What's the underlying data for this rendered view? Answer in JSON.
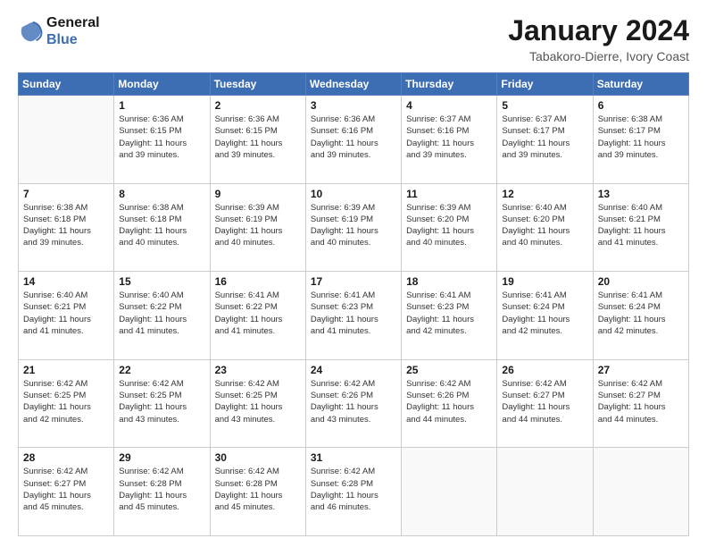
{
  "logo": {
    "line1": "General",
    "line2": "Blue"
  },
  "title": "January 2024",
  "subtitle": "Tabakoro-Dierre, Ivory Coast",
  "days_of_week": [
    "Sunday",
    "Monday",
    "Tuesday",
    "Wednesday",
    "Thursday",
    "Friday",
    "Saturday"
  ],
  "weeks": [
    [
      {
        "day": "",
        "info": ""
      },
      {
        "day": "1",
        "info": "Sunrise: 6:36 AM\nSunset: 6:15 PM\nDaylight: 11 hours\nand 39 minutes."
      },
      {
        "day": "2",
        "info": "Sunrise: 6:36 AM\nSunset: 6:15 PM\nDaylight: 11 hours\nand 39 minutes."
      },
      {
        "day": "3",
        "info": "Sunrise: 6:36 AM\nSunset: 6:16 PM\nDaylight: 11 hours\nand 39 minutes."
      },
      {
        "day": "4",
        "info": "Sunrise: 6:37 AM\nSunset: 6:16 PM\nDaylight: 11 hours\nand 39 minutes."
      },
      {
        "day": "5",
        "info": "Sunrise: 6:37 AM\nSunset: 6:17 PM\nDaylight: 11 hours\nand 39 minutes."
      },
      {
        "day": "6",
        "info": "Sunrise: 6:38 AM\nSunset: 6:17 PM\nDaylight: 11 hours\nand 39 minutes."
      }
    ],
    [
      {
        "day": "7",
        "info": "Sunrise: 6:38 AM\nSunset: 6:18 PM\nDaylight: 11 hours\nand 39 minutes."
      },
      {
        "day": "8",
        "info": "Sunrise: 6:38 AM\nSunset: 6:18 PM\nDaylight: 11 hours\nand 40 minutes."
      },
      {
        "day": "9",
        "info": "Sunrise: 6:39 AM\nSunset: 6:19 PM\nDaylight: 11 hours\nand 40 minutes."
      },
      {
        "day": "10",
        "info": "Sunrise: 6:39 AM\nSunset: 6:19 PM\nDaylight: 11 hours\nand 40 minutes."
      },
      {
        "day": "11",
        "info": "Sunrise: 6:39 AM\nSunset: 6:20 PM\nDaylight: 11 hours\nand 40 minutes."
      },
      {
        "day": "12",
        "info": "Sunrise: 6:40 AM\nSunset: 6:20 PM\nDaylight: 11 hours\nand 40 minutes."
      },
      {
        "day": "13",
        "info": "Sunrise: 6:40 AM\nSunset: 6:21 PM\nDaylight: 11 hours\nand 41 minutes."
      }
    ],
    [
      {
        "day": "14",
        "info": "Sunrise: 6:40 AM\nSunset: 6:21 PM\nDaylight: 11 hours\nand 41 minutes."
      },
      {
        "day": "15",
        "info": "Sunrise: 6:40 AM\nSunset: 6:22 PM\nDaylight: 11 hours\nand 41 minutes."
      },
      {
        "day": "16",
        "info": "Sunrise: 6:41 AM\nSunset: 6:22 PM\nDaylight: 11 hours\nand 41 minutes."
      },
      {
        "day": "17",
        "info": "Sunrise: 6:41 AM\nSunset: 6:23 PM\nDaylight: 11 hours\nand 41 minutes."
      },
      {
        "day": "18",
        "info": "Sunrise: 6:41 AM\nSunset: 6:23 PM\nDaylight: 11 hours\nand 42 minutes."
      },
      {
        "day": "19",
        "info": "Sunrise: 6:41 AM\nSunset: 6:24 PM\nDaylight: 11 hours\nand 42 minutes."
      },
      {
        "day": "20",
        "info": "Sunrise: 6:41 AM\nSunset: 6:24 PM\nDaylight: 11 hours\nand 42 minutes."
      }
    ],
    [
      {
        "day": "21",
        "info": "Sunrise: 6:42 AM\nSunset: 6:25 PM\nDaylight: 11 hours\nand 42 minutes."
      },
      {
        "day": "22",
        "info": "Sunrise: 6:42 AM\nSunset: 6:25 PM\nDaylight: 11 hours\nand 43 minutes."
      },
      {
        "day": "23",
        "info": "Sunrise: 6:42 AM\nSunset: 6:25 PM\nDaylight: 11 hours\nand 43 minutes."
      },
      {
        "day": "24",
        "info": "Sunrise: 6:42 AM\nSunset: 6:26 PM\nDaylight: 11 hours\nand 43 minutes."
      },
      {
        "day": "25",
        "info": "Sunrise: 6:42 AM\nSunset: 6:26 PM\nDaylight: 11 hours\nand 44 minutes."
      },
      {
        "day": "26",
        "info": "Sunrise: 6:42 AM\nSunset: 6:27 PM\nDaylight: 11 hours\nand 44 minutes."
      },
      {
        "day": "27",
        "info": "Sunrise: 6:42 AM\nSunset: 6:27 PM\nDaylight: 11 hours\nand 44 minutes."
      }
    ],
    [
      {
        "day": "28",
        "info": "Sunrise: 6:42 AM\nSunset: 6:27 PM\nDaylight: 11 hours\nand 45 minutes."
      },
      {
        "day": "29",
        "info": "Sunrise: 6:42 AM\nSunset: 6:28 PM\nDaylight: 11 hours\nand 45 minutes."
      },
      {
        "day": "30",
        "info": "Sunrise: 6:42 AM\nSunset: 6:28 PM\nDaylight: 11 hours\nand 45 minutes."
      },
      {
        "day": "31",
        "info": "Sunrise: 6:42 AM\nSunset: 6:28 PM\nDaylight: 11 hours\nand 46 minutes."
      },
      {
        "day": "",
        "info": ""
      },
      {
        "day": "",
        "info": ""
      },
      {
        "day": "",
        "info": ""
      }
    ]
  ]
}
